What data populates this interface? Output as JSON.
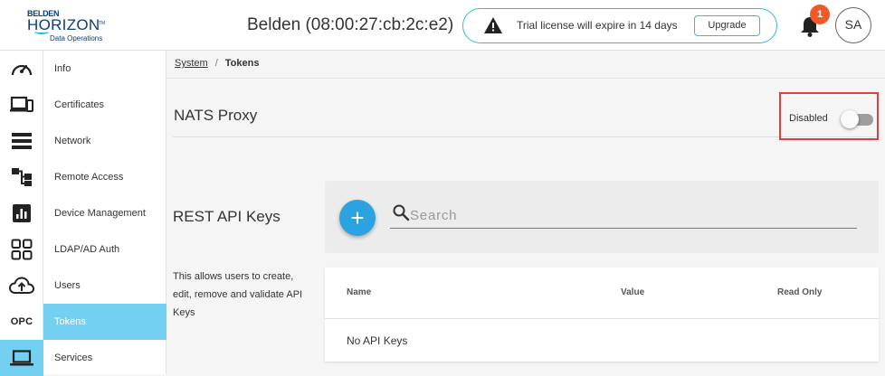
{
  "header": {
    "logo": {
      "brand": "BELDEN",
      "product": "HORIZON",
      "trademark": "TM",
      "tagline": "Data Operations"
    },
    "device_title": "Belden (08:00:27:cb:2c:e2)",
    "trial_banner": {
      "message": "Trial license will expire in 14 days",
      "upgrade_label": "Upgrade"
    },
    "notifications": {
      "count": "1"
    },
    "avatar": {
      "initials": "SA"
    }
  },
  "rail": {
    "items": [
      {
        "icon": "dashboard-gauge-icon"
      },
      {
        "icon": "devices-icon"
      },
      {
        "icon": "list-icon"
      },
      {
        "icon": "flow-hierarchy-icon"
      },
      {
        "icon": "analytics-chart-icon"
      },
      {
        "icon": "apps-grid-icon"
      },
      {
        "icon": "cloud-upload-icon"
      },
      {
        "icon": "opc-icon",
        "label": "OPC"
      },
      {
        "icon": "laptop-icon",
        "active": true
      }
    ]
  },
  "subnav": {
    "items": [
      {
        "label": "Info"
      },
      {
        "label": "Certificates"
      },
      {
        "label": "Network"
      },
      {
        "label": "Remote Access"
      },
      {
        "label": "Device Management"
      },
      {
        "label": "LDAP/AD Auth"
      },
      {
        "label": "Users"
      },
      {
        "label": "Tokens",
        "active": true
      },
      {
        "label": "Services"
      }
    ]
  },
  "breadcrumb": {
    "parent": "System",
    "separator": "/",
    "current": "Tokens"
  },
  "nats_proxy": {
    "title": "NATS Proxy",
    "toggle_label": "Disabled",
    "enabled": false
  },
  "rest_api": {
    "title": "REST API Keys",
    "description": "This allows users to create, edit, remove and validate API Keys",
    "add_label": "+",
    "search": {
      "placeholder": "Search",
      "value": ""
    },
    "table": {
      "columns": [
        "Name",
        "Value",
        "Read Only"
      ],
      "empty_message": "No API Keys"
    }
  },
  "colors": {
    "accent": "#74d0f1",
    "primary_button": "#2aa3e0",
    "badge": "#f05a28",
    "highlight_border": "#d9423b",
    "banner_border": "#3ab6d8"
  }
}
